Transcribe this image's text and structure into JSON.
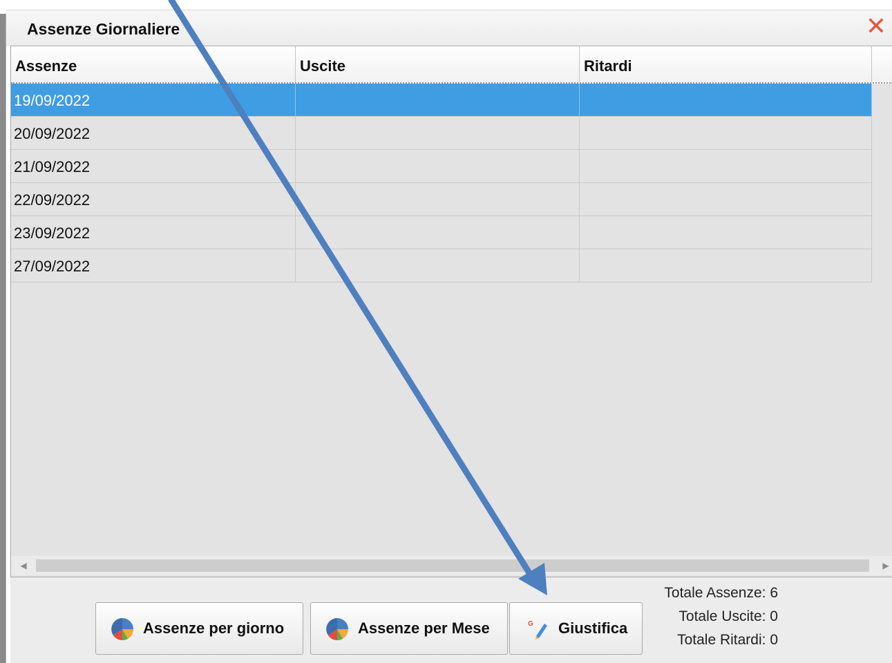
{
  "window": {
    "title": "Assenze Giornaliere",
    "close_icon": "close-x-icon",
    "close_color": "#e8553a"
  },
  "table": {
    "columns": [
      "Assenze",
      "Uscite",
      "Ritardi"
    ],
    "rows": [
      {
        "assenze": "19/09/2022",
        "uscite": "",
        "ritardi": "",
        "selected": true
      },
      {
        "assenze": "20/09/2022",
        "uscite": "",
        "ritardi": ""
      },
      {
        "assenze": "21/09/2022",
        "uscite": "",
        "ritardi": ""
      },
      {
        "assenze": "22/09/2022",
        "uscite": "",
        "ritardi": ""
      },
      {
        "assenze": "23/09/2022",
        "uscite": "",
        "ritardi": ""
      },
      {
        "assenze": "27/09/2022",
        "uscite": "",
        "ritardi": ""
      }
    ],
    "selected_color": "#3f9de3"
  },
  "buttons": {
    "per_giorno": "Assenze per giorno",
    "per_mese": "Assenze per Mese",
    "giustifica": "Giustifica"
  },
  "icons": {
    "per_giorno": "pie-chart-icon",
    "per_mese": "pie-chart-icon",
    "giustifica": "pencil-icon"
  },
  "totals": {
    "assenze": "Totale Assenze: 6",
    "uscite": "Totale Uscite: 0",
    "ritardi": "Totale Ritardi: 0"
  },
  "annotation": {
    "arrow_color": "#4e7fbf"
  }
}
